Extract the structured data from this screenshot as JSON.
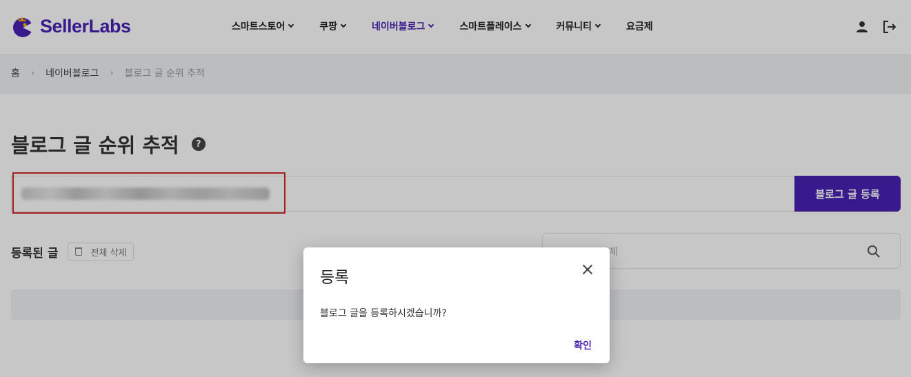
{
  "brand": {
    "name": "SellerLabs",
    "color": "#4a22b5"
  },
  "nav": {
    "items": [
      {
        "label": "스마트스토어",
        "has_menu": true,
        "active": false
      },
      {
        "label": "쿠팡",
        "has_menu": true,
        "active": false
      },
      {
        "label": "네이버블로그",
        "has_menu": true,
        "active": true
      },
      {
        "label": "스마트플레이스",
        "has_menu": true,
        "active": false
      },
      {
        "label": "커뮤니티",
        "has_menu": true,
        "active": false
      },
      {
        "label": "요금제",
        "has_menu": false,
        "active": false
      }
    ],
    "icons": [
      "user-icon",
      "logout-icon"
    ]
  },
  "breadcrumb": {
    "home": "홈",
    "section": "네이버블로그",
    "current": "블로그 글 순위 추적"
  },
  "page": {
    "title": "블로그 글 순위 추적",
    "help_label": "?",
    "register_button": "블로그 글 등록",
    "list_title": "등록된 글",
    "delete_all_button": "전체 삭제",
    "search_placeholder": "제"
  },
  "dialog": {
    "title": "등록",
    "message": "블로그 글을 등록하시겠습니까?",
    "confirm_button": "확인"
  }
}
